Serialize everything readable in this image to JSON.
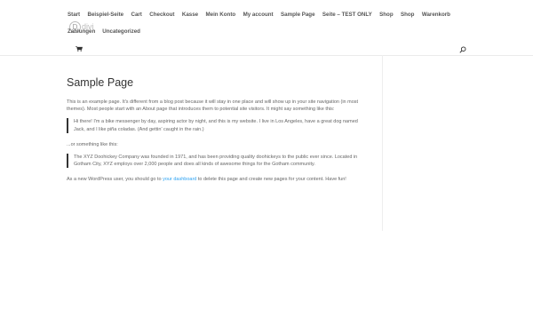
{
  "nav": {
    "row1": [
      "Start",
      "Beispiel-Seite",
      "Cart",
      "Checkout",
      "Kasse",
      "Mein Konto",
      "My account",
      "Sample Page",
      "Seite – TEST ONLY",
      "Shop",
      "Shop",
      "Warenkorb"
    ],
    "row2": [
      "Zahlungen",
      "Uncategorized"
    ]
  },
  "logo": {
    "letter": "D",
    "text": "divi"
  },
  "icons": {
    "cart": "cart-icon",
    "search": "search-icon"
  },
  "page": {
    "title": "Sample Page",
    "intro": "This is an example page. It's different from a blog post because it will stay in one place and will show up in your site navigation (in most themes). Most people start with an About page that introduces them to potential site visitors. It might say something like this:",
    "quote1": "Hi there! I'm a bike messenger by day, aspiring actor by night, and this is my website. I live in Los Angeles, have a great dog named Jack, and I like piña coladas. (And gettin' caught in the rain.)",
    "or_text": "...or something like this:",
    "quote2": "The XYZ Doohickey Company was founded in 1971, and has been providing quality doohickeys to the public ever since. Located in Gotham City, XYZ employs over 2,000 people and does all kinds of awesome things for the Gotham community.",
    "outro_before": "As a new WordPress user, you should go to ",
    "outro_link": "your dashboard",
    "outro_after": " to delete this page and create new pages for your content. Have fun!"
  },
  "colors": {
    "accent": "#2ea3f2",
    "text": "#666666",
    "heading": "#333333"
  }
}
